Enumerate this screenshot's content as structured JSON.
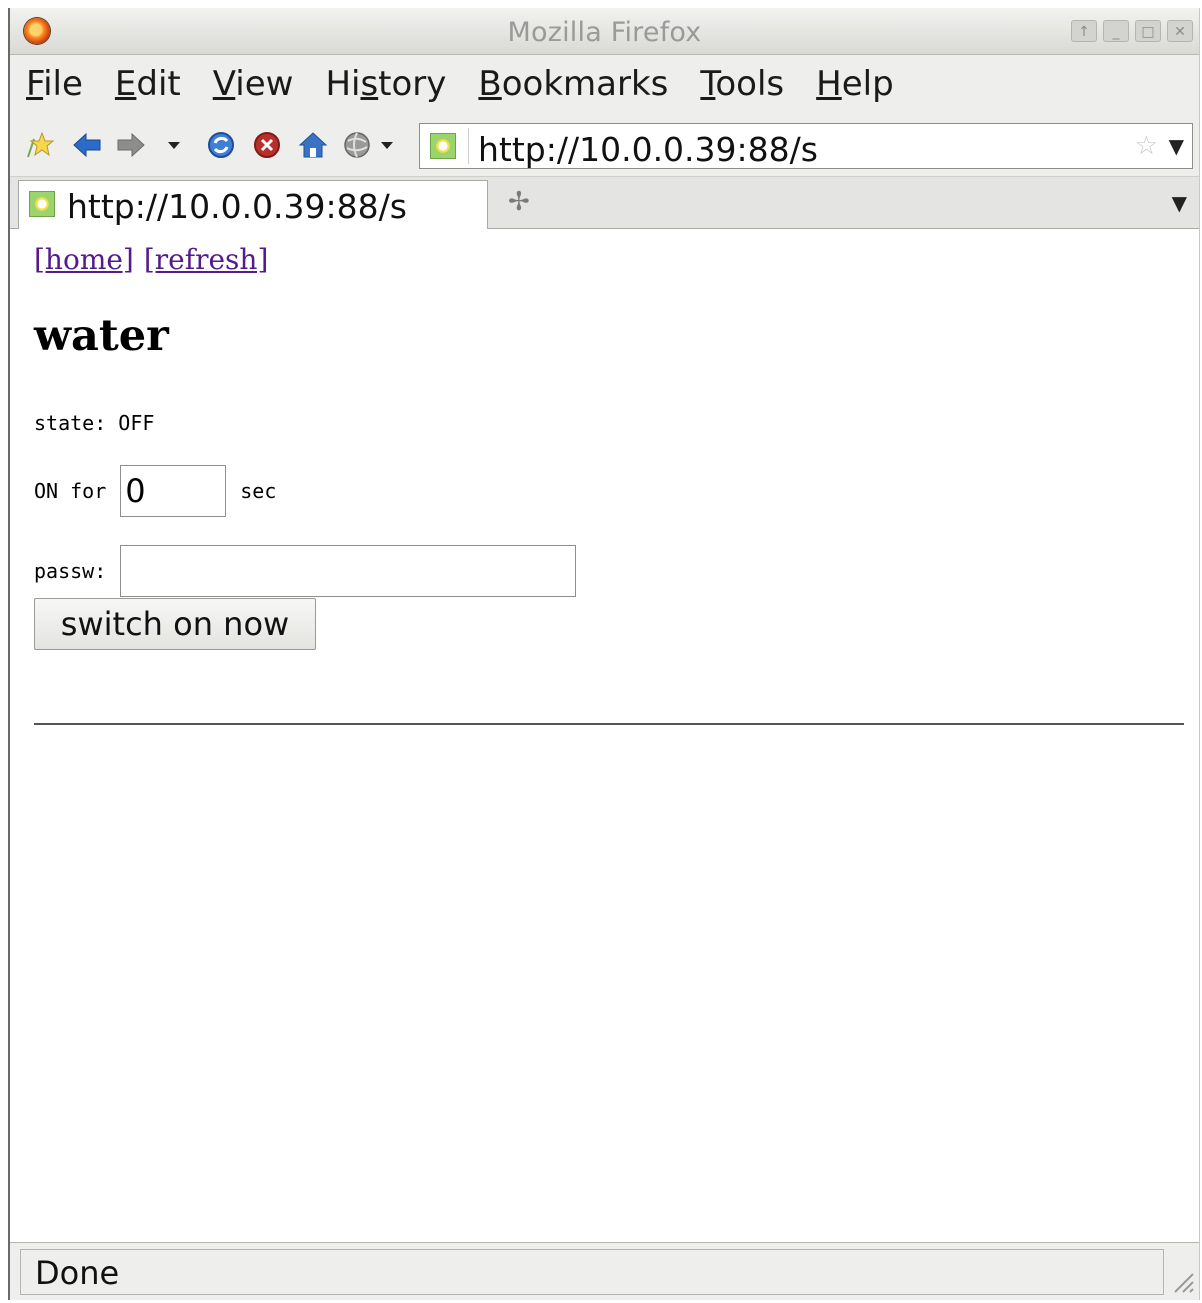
{
  "window": {
    "title": "Mozilla Firefox"
  },
  "menubar": {
    "items": [
      {
        "label": "File",
        "u": "F",
        "rest": "ile",
        "pre": ""
      },
      {
        "label": "Edit",
        "u": "E",
        "rest": "dit",
        "pre": ""
      },
      {
        "label": "View",
        "u": "V",
        "rest": "iew",
        "pre": ""
      },
      {
        "label": "History",
        "pre": "Hi",
        "u": "s",
        "rest": "tory"
      },
      {
        "label": "Bookmarks",
        "u": "B",
        "rest": "ookmarks",
        "pre": ""
      },
      {
        "label": "Tools",
        "u": "T",
        "rest": "ools",
        "pre": ""
      },
      {
        "label": "Help",
        "u": "H",
        "rest": "elp",
        "pre": ""
      }
    ]
  },
  "navbar": {
    "url": "http://10.0.0.39:88/s"
  },
  "tabs": [
    {
      "label": "http://10.0.0.39:88/s"
    }
  ],
  "page": {
    "links": {
      "home": "[home]",
      "refresh": "[refresh]"
    },
    "heading": "water",
    "state_label": "state:",
    "state_value": "OFF",
    "on_for_label": "ON for",
    "on_for_value": "0",
    "sec_label": "sec",
    "passw_label": "passw:",
    "passw_value": "",
    "submit_label": "switch on now"
  },
  "status": {
    "text": "Done"
  },
  "colors": {
    "link_visited": "#551a8b",
    "chrome_bg": "#eeeeec"
  }
}
